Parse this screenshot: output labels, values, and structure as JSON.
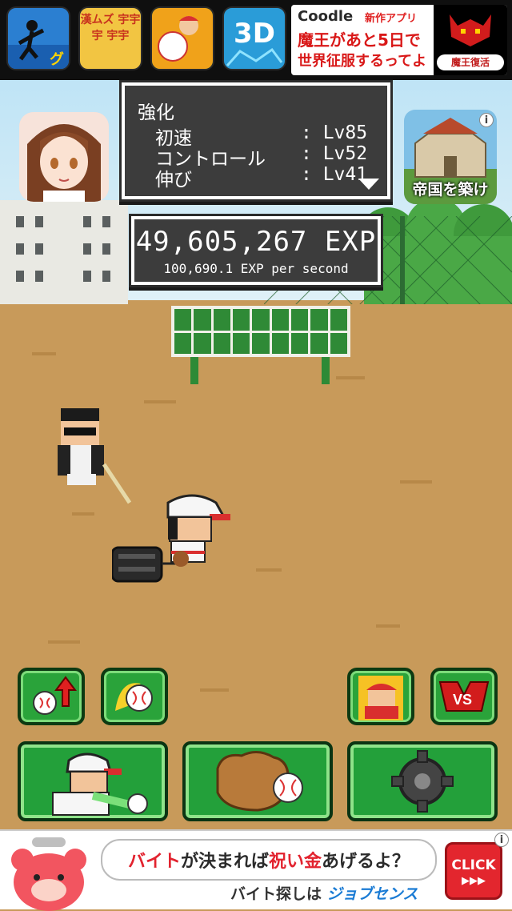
{
  "top_ads": {
    "icons": [
      {
        "label": "",
        "bg": "#2b7fd1"
      },
      {
        "label": "漢ムズ 宇宇宇 宇宇",
        "bg": "#f2c542"
      },
      {
        "label": "",
        "bg": "#3aa02b"
      },
      {
        "label": "3D",
        "bg": "#2a9cd8"
      }
    ],
    "banner": {
      "brand": "Coodle",
      "tag": "新作アプリ",
      "line1": "魔王があと5日で",
      "line2": "世界征服するってよ",
      "badge": "魔王復活"
    }
  },
  "skill_panel": {
    "title": "強化",
    "rows": [
      {
        "name": "初速",
        "level": ": Lv85"
      },
      {
        "name": "コントロール",
        "level": ": Lv52"
      },
      {
        "name": "伸び",
        "level": ": Lv41"
      }
    ]
  },
  "exp_panel": {
    "total": "49,605,267 EXP",
    "rate": "100,690.1 EXP per second"
  },
  "side_ads": {
    "right_label": "帝国を築け",
    "info": "i"
  },
  "bottom_ad": {
    "headline_a": "バイト",
    "headline_b": "が決まれば",
    "headline_c": "祝い金",
    "headline_d": "あげるよ？",
    "sub_a": "バイト探しは",
    "sub_brand": "ジョブセンス",
    "click": "CLICK",
    "arrows": "▶▶▶",
    "info": "i"
  },
  "colors": {
    "panel_bg": "#3c3c3c",
    "button_green": "#23a03a",
    "ground": "#c89a5a"
  }
}
